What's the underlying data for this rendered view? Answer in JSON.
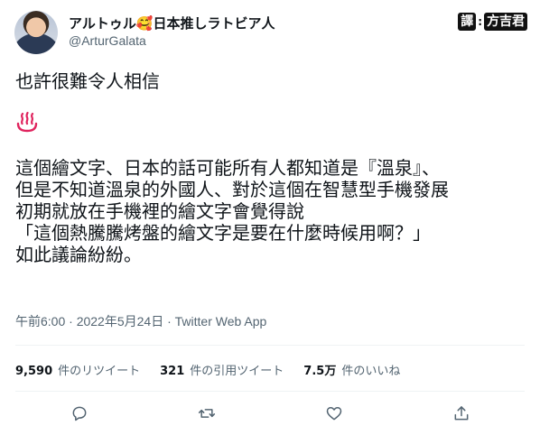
{
  "author": {
    "display_name": "アルトゥル🥰日本推しラトビア人",
    "handle": "@ArturGalata"
  },
  "translator_stamp": {
    "left": "譯",
    "right": "方吉君"
  },
  "tweet": {
    "lines_intro": [
      "也許很難令人相信"
    ],
    "emoji": "hot-springs-icon",
    "lines_body": [
      "這個繪文字、日本的話可能所有人都知道是『溫泉』、",
      "但是不知道溫泉的外國人、對於這個在智慧型手機發展",
      "初期就放在手機裡的繪文字會覺得說",
      "「這個熱騰騰烤盤的繪文字是要在什麼時候用啊？」",
      "如此議論紛紛。"
    ],
    "timestamp": "午前6:00 · 2022年5月24日 · ",
    "source": "Twitter Web App"
  },
  "stats": {
    "retweets_count": "9,590",
    "retweets_label": "件のリツイート",
    "quotes_count": "321",
    "quotes_label": "件の引用ツイート",
    "likes_count": "7.5万",
    "likes_label": "件のいいね"
  },
  "actions": [
    "reply-icon",
    "retweet-icon",
    "like-icon",
    "share-icon"
  ],
  "colors": {
    "text": "#0f1419",
    "secondary": "#536471",
    "divider": "#eff3f4",
    "onsen": "#e0245e"
  }
}
